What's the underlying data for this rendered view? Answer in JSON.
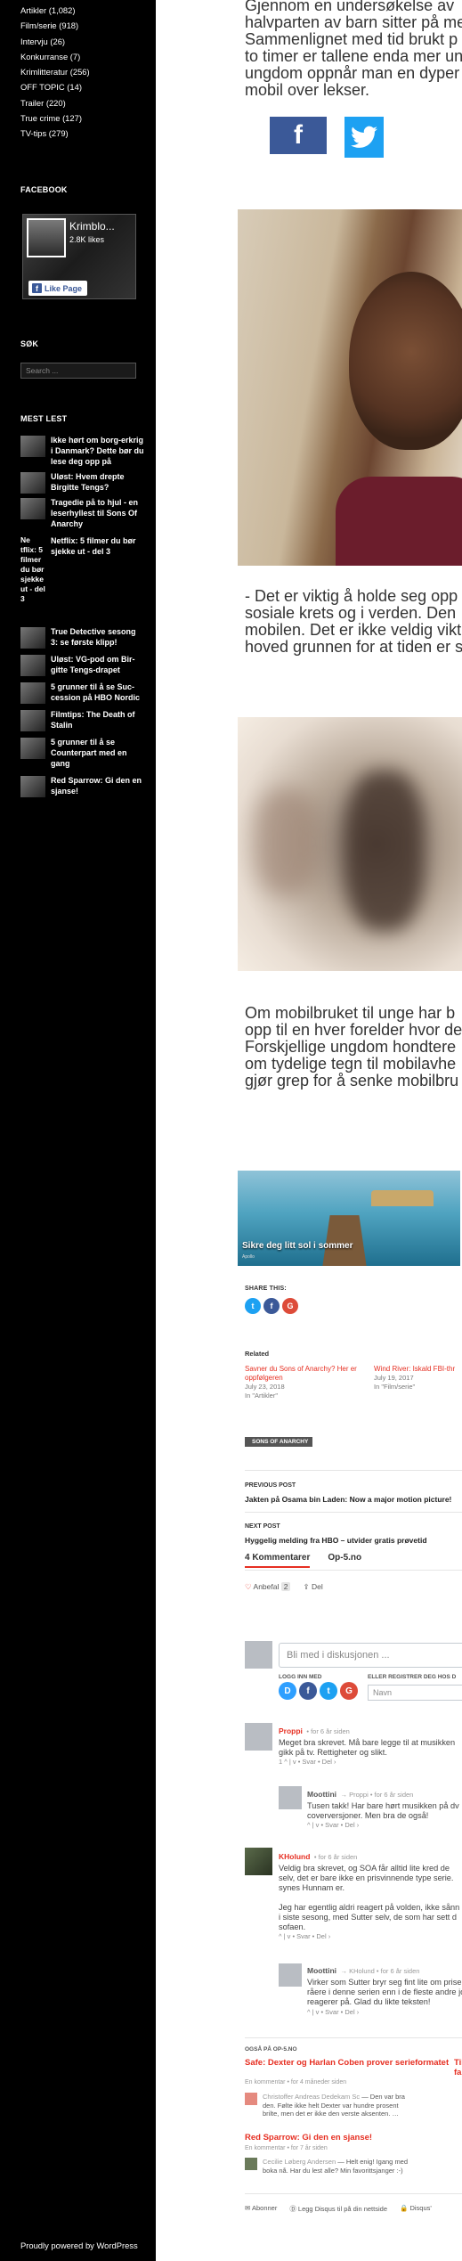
{
  "sidebar": {
    "categories": [
      {
        "label": "Artikler",
        "count": "(1,082)"
      },
      {
        "label": "Film/serie",
        "count": "(918)"
      },
      {
        "label": "Intervju",
        "count": "(26)"
      },
      {
        "label": "Konkurranse",
        "count": "(7)"
      },
      {
        "label": "Krimlitteratur",
        "count": "(256)"
      },
      {
        "label": "OFF TOPIC",
        "count": "(14)"
      },
      {
        "label": "Trailer",
        "count": "(220)"
      },
      {
        "label": "True crime",
        "count": "(127)"
      },
      {
        "label": "TV-tips",
        "count": "(279)"
      }
    ],
    "facebook_title": "FACEBOOK",
    "fb_page_name": "Krimblo...",
    "fb_likes": "2.8K likes",
    "fb_like_label": "Like Page",
    "search_title": "SØK",
    "search_placeholder": "Search ...",
    "mest_lest_title": "MEST LEST",
    "mest_lest": [
      "Ikke hørt om borg-erkrig i Danmark? Dette bør du lese deg opp på",
      "Uløst: Hvem drepte Birgitte Tengs?",
      "Tragedie på to hjul - en leserhyllest til Sons Of Anarchy",
      "Netflix: 5 filmer du bør sjekke ut - del 3",
      "True Detective sesong 3: se første klipp!",
      "Uløst: VG-pod om Bir-gitte Tengs-drapet",
      "5 grunner til å se Suc-cession på HBO Nordic",
      "Filmtips: The Death of Stalin",
      "5 grunner til å se Counterpart med en gang",
      "Red Sparrow: Gi den en sjanse!"
    ],
    "mest_lest_alt": "Ne tflix: 5 filmer du bør sjekke ut - del 3",
    "powered": "Proudly powered by WordPress"
  },
  "article": {
    "intro_lines": [
      "Gjennom en undersøkelse av",
      "halvparten av barn sitter på me",
      "Sammenlignet med tid brukt p",
      "to timer er tallene enda mer un",
      "ungdom oppnår man en dyper",
      "mobil over lekser."
    ],
    "middle_lines": [
      "- Det er viktig å holde seg opp",
      "sosiale krets og i verden. Den",
      "mobilen. Det er ikke veldig vikt",
      "hoved grunnen for at tiden er s"
    ],
    "lower_lines": [
      "Om mobilbruket til unge har b",
      "opp til en hver forelder hvor de",
      "Forskjellige ungdom hondtere",
      "om tydelige tegn til mobilavhe",
      "gjør grep for å senke mobilbru"
    ],
    "share_fb_glyph": "f",
    "promo_caption": "Sikre deg litt sol i sommer",
    "promo_sub": "Apollo"
  },
  "share": {
    "label": "SHARE THIS:"
  },
  "related": {
    "label": "Related",
    "items": [
      {
        "title": "Savner du Sons of Anarchy? Her er oppfølgeren",
        "date": "July 23, 2018",
        "cat": "In \"Artikler\""
      },
      {
        "title": "Wind River: Iskald FBI-thr",
        "date": "July 19, 2017",
        "cat": "In \"Film/serie\""
      }
    ]
  },
  "tag": "SONS OF ANARCHY",
  "post_nav": {
    "prev_label": "PREVIOUS POST",
    "prev_title": "Jakten på Osama bin Laden: Now a major motion picture!",
    "next_label": "NEXT POST",
    "next_title": "Hyggelig melding fra HBO – utvider gratis prøvetid"
  },
  "disqus": {
    "tab_comments": "4 Kommentarer",
    "tab_site": "Op-5.no",
    "recommend": "Anbefal",
    "recommend_count": "2",
    "share": "Del",
    "input_placeholder": "Bli med i diskusjonen ...",
    "login_label": "LOGG INN MED",
    "or_register": "ELLER REGISTRER DEG HOS D",
    "name_placeholder": "Navn",
    "comments": [
      {
        "author": "Proppi",
        "meta": "• for 6 år siden",
        "lines": [
          "Meget bra skrevet. Må bare legge til at musikken",
          "gikk på tv. Rettigheter og slikt."
        ],
        "actions": "1 ^ | v • Svar • Del ›"
      },
      {
        "author": "Moottini",
        "meta": "→ Proppi • for 6 år siden",
        "lines": [
          "Tusen takk! Har bare hørt musikken på dv",
          "coverversjoner. Men bra de også!"
        ],
        "actions": "^ | v • Svar • Del ›"
      },
      {
        "author": "KHolund",
        "meta": "• for 6 år siden",
        "lines": [
          "Veldig bra skrevet, og SOA får alltid lite kred de",
          "selv, det er bare ikke en prisvinnende type serie.",
          "synes Hunnam er.",
          "",
          "Jeg har egentlig aldri reagert på volden, ikke sånn",
          "i siste sesong, med Sutter selv, de som har sett d",
          "sofaen."
        ],
        "actions": "^ | v • Svar • Del ›"
      },
      {
        "author": "Moottini",
        "meta": "→ KHolund • for 6 år siden",
        "lines": [
          "Virker som Sutter bryr seg fint lite om prise",
          "råere i denne serien enn i de fleste andre jo",
          "reagerer på. Glad du likte teksten!"
        ],
        "actions": "^ | v • Svar • Del ›"
      }
    ],
    "also_label": "OGSÅ PÅ OP-5.NO",
    "also": [
      {
        "title": "Safe: Dexter og Harlan Coben prover serieformatet",
        "meta": "En kommentar • for 4 måneder siden",
        "author": "Christoffer Andreas Dedekam Sc",
        "body_lines": [
          "— Den var bra",
          "den. Følte ikke helt Dexter var hundre prosent",
          "brilte, men det er ikke den verste aksenten. …"
        ]
      },
      {
        "title": "Red Sparrow: Gi den en sjanse!",
        "meta": "En kommentar • for 7 år siden",
        "author": "Cecilie Løberg Andersen",
        "body_lines": [
          "— Helt enig! Igang med",
          "boka nå. Har du lest alle? Min favorittsjanger :-)"
        ]
      }
    ],
    "also_second_col": [
      "Til",
      "fa"
    ],
    "footer_subscribe": "Abonner",
    "footer_disqus": "Legg Disqus til på din nettside",
    "footer_privacy": "Disqus'"
  },
  "colors": {
    "accent": "#e62f22",
    "facebook": "#3b5998",
    "twitter": "#1da1f2",
    "google": "#dd4b39",
    "disqus": "#2e9fff"
  }
}
